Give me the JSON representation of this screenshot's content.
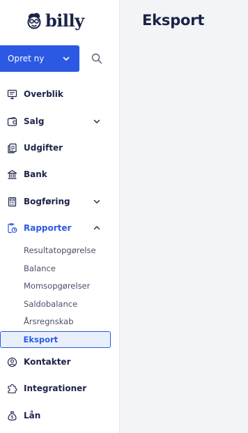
{
  "brand": {
    "name": "billy"
  },
  "sidebar": {
    "create_label": "Opret ny",
    "nav": {
      "overblik": "Overblik",
      "salg": "Salg",
      "udgifter": "Udgifter",
      "bank": "Bank",
      "bogforing": "Bogføring",
      "rapporter": "Rapporter",
      "kontakter": "Kontakter",
      "integrationer": "Integrationer",
      "lan": "Lån"
    },
    "reports": {
      "resultat": "Resultatopgørelse",
      "balance": "Balance",
      "moms": "Momsopgørelser",
      "saldo": "Saldobalance",
      "aarsregnskab": "Årsregnskab",
      "eksport": "Eksport"
    }
  },
  "main": {
    "title": "Eksport"
  },
  "colors": {
    "accent": "#2b59e4",
    "text": "#1c2347",
    "main_bg": "#f3f4f6"
  }
}
